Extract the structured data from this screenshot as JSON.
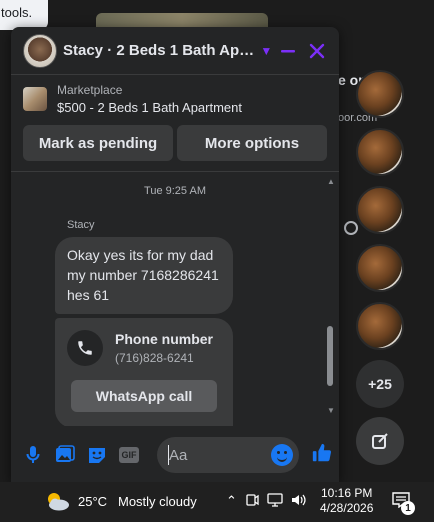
{
  "background": {
    "fragment_text": "tools.",
    "right_text": "e or",
    "right_subtext": "oor.com"
  },
  "chat": {
    "title": "Stacy · 2 Beds 1 Bath Apart···",
    "listing": {
      "source": "Marketplace",
      "name": "$500 - 2 Beds 1 Bath Apartment"
    },
    "actions": {
      "pending_label": "Mark as pending",
      "more_label": "More options"
    },
    "thread": {
      "timestamp": "Tue 9:25 AM",
      "sender": "Stacy",
      "message": "Okay yes its for my dad my number 7168286241 hes 61",
      "card": {
        "title": "Phone number",
        "number": "(716)828-6241",
        "button_label": "WhatsApp call"
      }
    },
    "composer": {
      "placeholder": "Aa"
    }
  },
  "rail": {
    "more_count": "+25"
  },
  "taskbar": {
    "temperature": "25°C",
    "condition": "Mostly cloudy",
    "time": "10:16 PM",
    "date": "4/28/2026",
    "notification_count": "1"
  },
  "colors": {
    "accent": "#7b2ff7",
    "messenger_blue": "#1877f2",
    "panel": "#242526",
    "bubble": "#3a3b3c"
  }
}
